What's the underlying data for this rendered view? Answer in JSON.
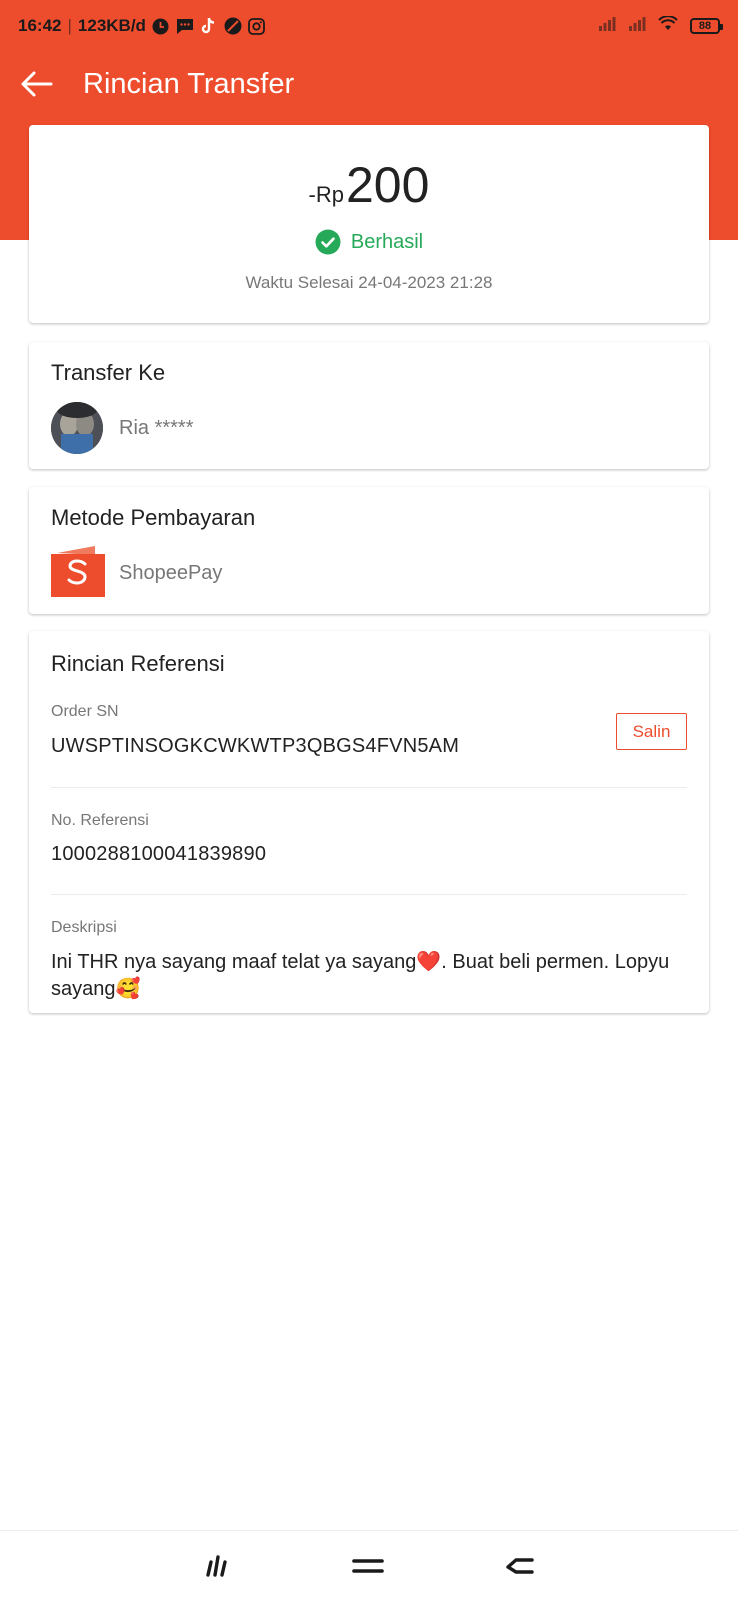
{
  "status_bar": {
    "time": "16:42",
    "speed": "123KB/d",
    "battery": "88"
  },
  "header": {
    "title": "Rincian Transfer"
  },
  "summary": {
    "amount_prefix": "-Rp",
    "amount": "200",
    "status": "Berhasil",
    "completed_time": "Waktu Selesai 24-04-2023 21:28"
  },
  "transfer": {
    "title": "Transfer Ke",
    "recipient": "Ria *****"
  },
  "payment": {
    "title": "Metode Pembayaran",
    "method": "ShopeePay"
  },
  "reference": {
    "title": "Rincian Referensi",
    "order_sn_label": "Order SN",
    "order_sn": "UWSPTINSOGKCWKWTP3QBGS4FVN5AM",
    "copy_label": "Salin",
    "ref_no_label": "No. Referensi",
    "ref_no": "1000288100041839890",
    "description_label": "Deskripsi",
    "description": "Ini THR nya sayang maaf telat ya sayang❤️. Buat beli permen. Lopyu sayang🥰"
  },
  "colors": {
    "brand": "#ee4d2d",
    "success": "#26aa59"
  }
}
